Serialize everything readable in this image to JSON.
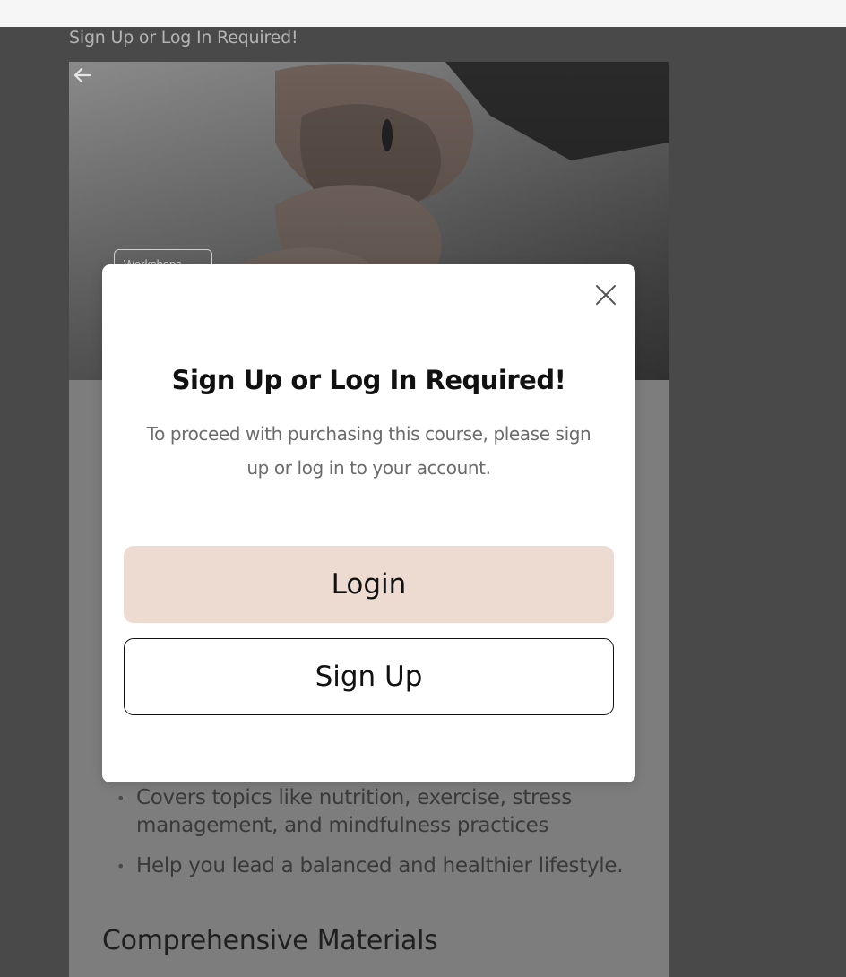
{
  "page": {
    "heading": "Sign Up or Log In Required!"
  },
  "hero": {
    "tag": "Workshops",
    "back_icon": "arrow-left-icon"
  },
  "content": {
    "bullets": [
      "Covers topics like nutrition, exercise, stress management, and mindfulness practices",
      "Help you lead a balanced and healthier lifestyle."
    ],
    "section_title": "Comprehensive Materials"
  },
  "modal": {
    "title": "Sign Up or Log In Required!",
    "message": "To proceed with purchasing this course, please sign up or log in to your account.",
    "login_label": "Login",
    "signup_label": "Sign Up",
    "close_icon": "close-icon"
  },
  "colors": {
    "overlay": "#494949",
    "login_button": "#eddbd2",
    "modal_background": "#ffffff"
  }
}
